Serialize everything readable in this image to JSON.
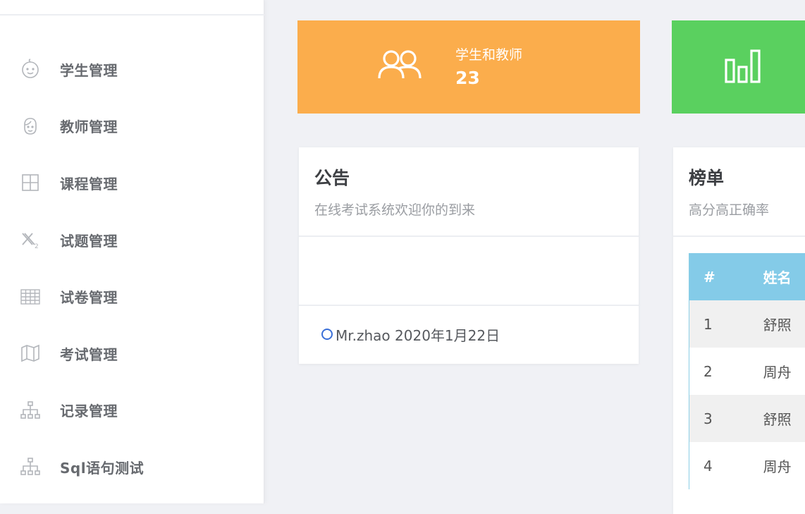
{
  "sidebar": {
    "items": [
      {
        "label": "学生管理",
        "icon": "baby-face-icon"
      },
      {
        "label": "教师管理",
        "icon": "face-icon"
      },
      {
        "label": "课程管理",
        "icon": "grid-icon"
      },
      {
        "label": "试题管理",
        "icon": "subscript-icon"
      },
      {
        "label": "试卷管理",
        "icon": "table-icon"
      },
      {
        "label": "考试管理",
        "icon": "map-icon"
      },
      {
        "label": "记录管理",
        "icon": "hierarchy-icon"
      },
      {
        "label": "Sql语句测试",
        "icon": "hierarchy-icon"
      }
    ]
  },
  "stats": {
    "users": {
      "label": "学生和教师",
      "value": "23",
      "color": "#fbad4c",
      "icon": "users-icon"
    },
    "chart": {
      "color": "#5ad05f",
      "icon": "bar-chart-icon"
    }
  },
  "notice": {
    "title": "公告",
    "subtitle": "在线考试系统欢迎你的到来",
    "entry": "Mr.zhao 2020年1月22日"
  },
  "rank": {
    "title": "榜单",
    "subtitle": "高分高正确率",
    "columns": [
      "#",
      "姓名"
    ],
    "rows": [
      {
        "idx": "1",
        "name": "舒照"
      },
      {
        "idx": "2",
        "name": "周舟"
      },
      {
        "idx": "3",
        "name": "舒照"
      },
      {
        "idx": "4",
        "name": "周舟"
      }
    ],
    "header_color": "#84cbe8"
  }
}
